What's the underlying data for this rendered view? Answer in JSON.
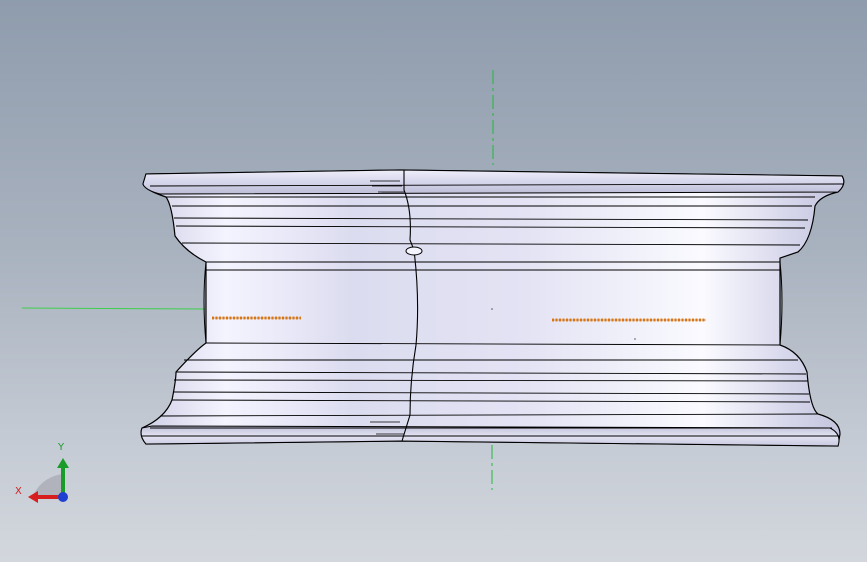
{
  "viewport": {
    "background_top": "#8f9cad",
    "background_bottom": "#d3d7dd"
  },
  "model": {
    "part": "wheel-rim",
    "view": "front",
    "body_color": "#d9d9ec",
    "highlight_color": "#ffffff",
    "shadow_color": "#b3b3cc",
    "edge_color": "#000000",
    "thread_color": "#e8811a"
  },
  "axes": {
    "x_label": "X",
    "y_label": "Y",
    "x_color": "#d61e1e",
    "y_color": "#1a9b2a",
    "z_color": "#1f3fd1"
  },
  "icons": {
    "triad": "coordinate-triad-icon"
  }
}
